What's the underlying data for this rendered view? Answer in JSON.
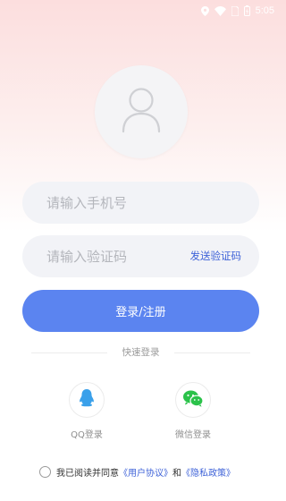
{
  "status_bar": {
    "time": "5:05",
    "icons": [
      "location-icon",
      "wifi-icon",
      "sim-icon",
      "battery-icon"
    ]
  },
  "avatar": {
    "icon": "user-icon"
  },
  "phone_input": {
    "placeholder": "请输入手机号",
    "value": ""
  },
  "code_input": {
    "placeholder": "请输入验证码",
    "value": ""
  },
  "send_code_label": "发送验证码",
  "login_button_label": "登录/注册",
  "quick_login_label": "快速登录",
  "social": {
    "qq_label": "QQ登录",
    "wechat_label": "微信登录"
  },
  "agreement": {
    "prefix": "我已阅读并同意",
    "user_agreement": "《用户协议》",
    "and": "和",
    "privacy_policy": "《隐私政策》",
    "checked": false
  },
  "colors": {
    "primary": "#5b84f0",
    "link": "#3f63d8",
    "qq_blue": "#3aa0ea",
    "wechat_green": "#2bc24a",
    "field_bg": "#f2f3f7"
  }
}
